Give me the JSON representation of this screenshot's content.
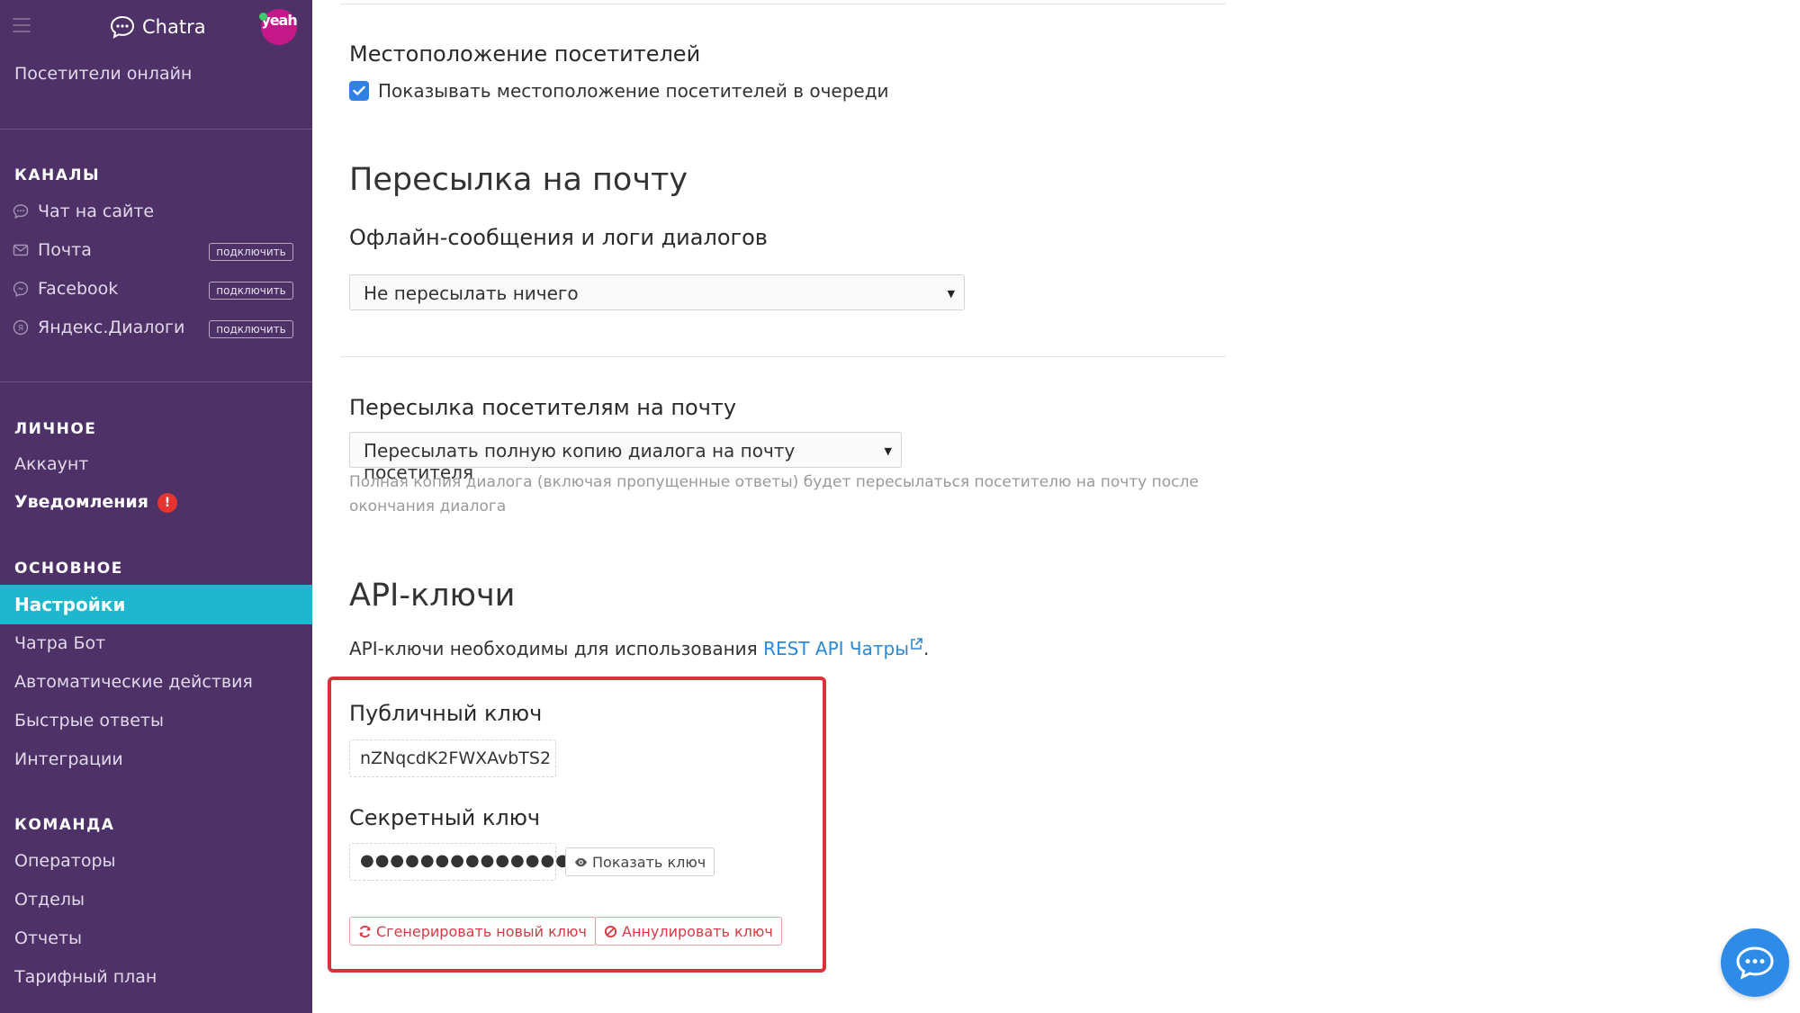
{
  "sidebar": {
    "brand": "Chatra",
    "avatar_text": "yeah",
    "visitors_online": "Посетители онлайн",
    "channels_head": "КАНАЛЫ",
    "channels": [
      {
        "label": "Чат на сайте",
        "icon": "chat-bubble-icon",
        "action": ""
      },
      {
        "label": "Почта",
        "icon": "envelope-icon",
        "action": "подключить"
      },
      {
        "label": "Facebook",
        "icon": "messenger-icon",
        "action": "подключить"
      },
      {
        "label": "Яндекс.Диалоги",
        "icon": "yandex-dialogs-icon",
        "action": "подключить"
      }
    ],
    "personal_head": "ЛИЧНОЕ",
    "account": "Аккаунт",
    "notifications": "Уведомления",
    "notifications_badge": "!",
    "main_head": "ОСНОВНОЕ",
    "settings": "Настройки",
    "bot": "Чатра Бот",
    "auto_actions": "Автоматические действия",
    "quick_replies": "Быстрые ответы",
    "integrations": "Интеграции",
    "team_head": "КОМАНДА",
    "operators": "Операторы",
    "departments": "Отделы",
    "reports": "Отчеты",
    "plan": "Тарифный план"
  },
  "main": {
    "location_title": "Местоположение посетителей",
    "location_checkbox": "Показывать местоположение посетителей в очереди",
    "location_checked": true,
    "forward_title": "Пересылка на почту",
    "offline_title": "Офлайн-сообщения и логи диалогов",
    "offline_select": "Не пересылать ничего",
    "visitors_forward_title": "Пересылка посетителям на почту",
    "visitors_forward_select": "Пересылать полную копию диалога на почту посетителя",
    "visitors_forward_hint": "Полная копия диалога (включая пропущенные ответы) будет пересылаться посетителю на почту после окончания диалога",
    "api_title": "API-ключи",
    "api_desc_prefix": "API-ключи необходимы для использования ",
    "api_link": "REST API Чатры",
    "api_desc_suffix": ".",
    "public_key_label": "Публичный ключ",
    "public_key_value": "nZNqcdK2FWXAvbTS2",
    "secret_key_label": "Секретный ключ",
    "secret_key_value": "●●●●●●●●●●●●●●●●●",
    "show_key_button": "Показать ключ",
    "regenerate_button": "Сгенерировать новый ключ",
    "revoke_button": "Аннулировать ключ"
  },
  "colors": {
    "sidebar_bg": "#4e3267",
    "active_item": "#1fb7cf",
    "link": "#2b89d8",
    "highlight_border": "#d8333a",
    "chat_widget": "#2e8ce8"
  }
}
